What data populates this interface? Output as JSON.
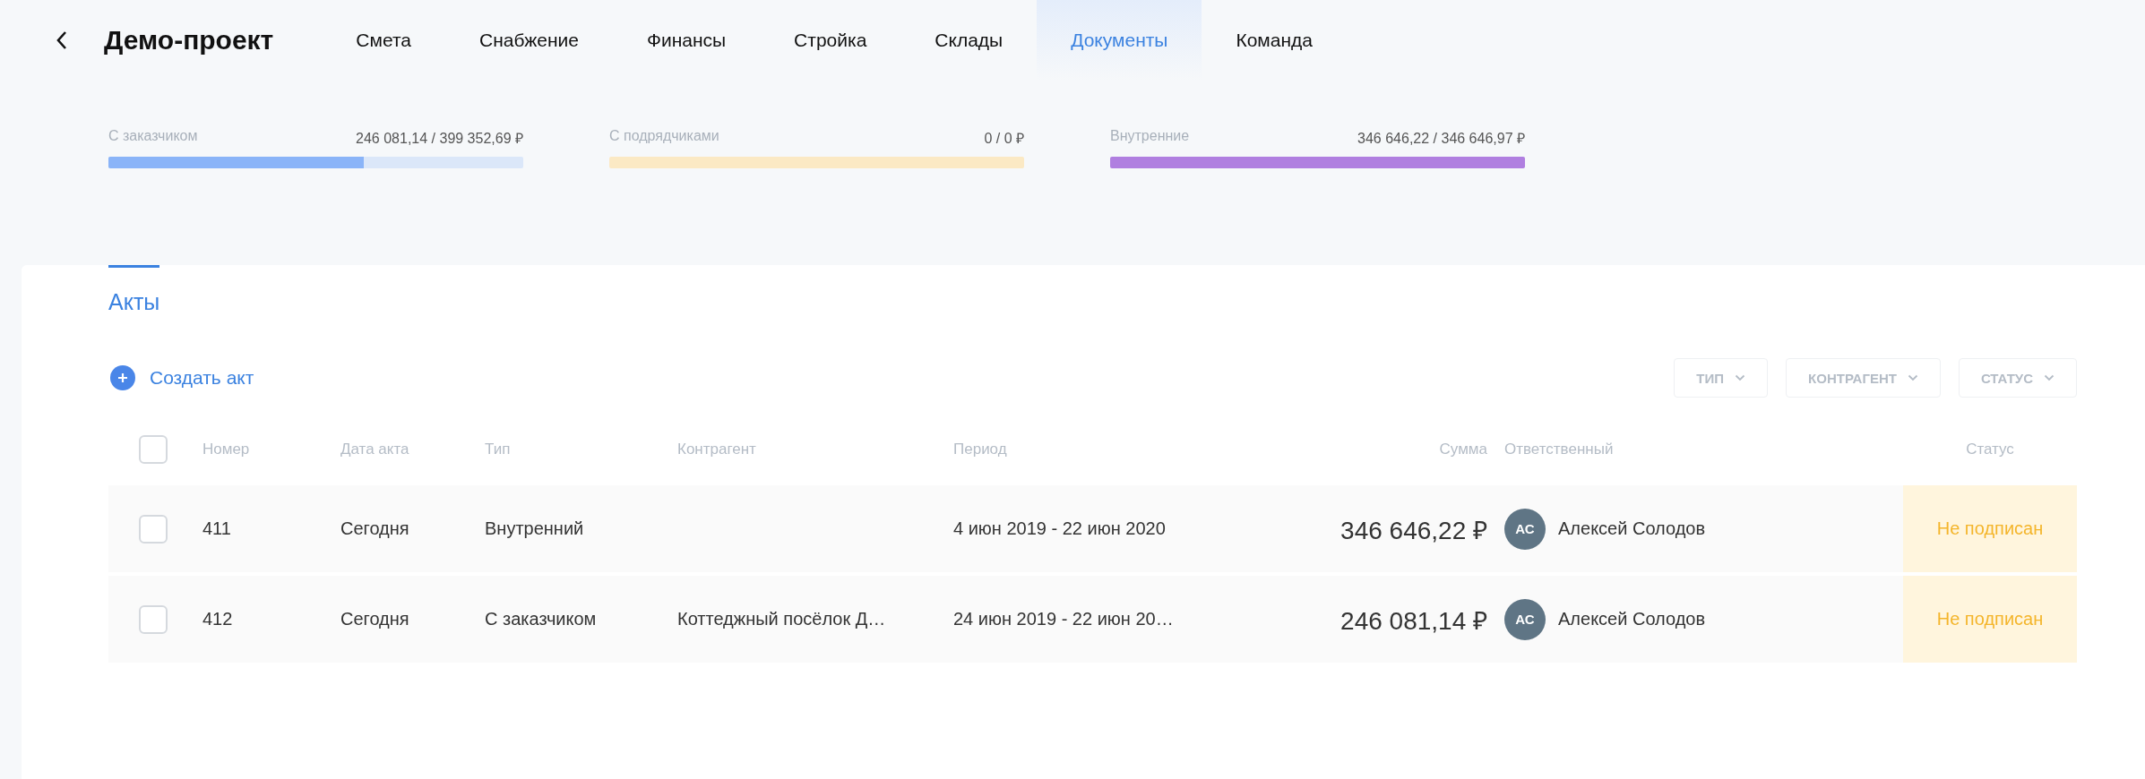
{
  "header": {
    "title": "Демо-проект"
  },
  "nav_tabs": [
    {
      "label": "Смета",
      "selected": false
    },
    {
      "label": "Снабжение",
      "selected": false
    },
    {
      "label": "Финансы",
      "selected": false
    },
    {
      "label": "Стройка",
      "selected": false
    },
    {
      "label": "Склады",
      "selected": false
    },
    {
      "label": "Документы",
      "selected": true
    },
    {
      "label": "Команда",
      "selected": false
    }
  ],
  "summary": [
    {
      "label": "С заказчиком",
      "amount": "246 081,14 / 399 352,69 ₽",
      "level": 0.616,
      "color": "#8ab4f8"
    },
    {
      "label": "С подрядчиками",
      "amount": "0 / 0 ₽",
      "level": 0,
      "color": "#fbe9c4"
    },
    {
      "label": "Внутренние",
      "amount": "346 646,22 / 346 646,97 ₽",
      "level": 1,
      "color": "#b07fe0"
    }
  ],
  "section_tab": {
    "label": "Акты",
    "selected": true
  },
  "create_button": "Создать акт",
  "filters": [
    "ТИП",
    "КОНТРАГЕНТ",
    "СТАТУС"
  ],
  "table": {
    "select_all_checked": false,
    "columns": [
      "Номер",
      "Дата акта",
      "Тип",
      "Контрагент",
      "Период",
      "Сумма",
      "Ответственный",
      "Статус"
    ],
    "rows": [
      {
        "checked": false,
        "number": "411",
        "date": "Сегодня",
        "type": "Внутренний",
        "contractor": "",
        "period": "4 июн 2019 - 22 июн 2020",
        "sum": "346 646,22 ₽",
        "initials": "АС",
        "responsible": "Алексей Солодов",
        "status": {
          "label": "Не подписан",
          "kind": "unsigned"
        }
      },
      {
        "checked": false,
        "number": "412",
        "date": "Сегодня",
        "type": "С заказчиком",
        "contractor": "Коттеджный посёлок Д…",
        "period": "24 июн 2019 - 22 июн 20…",
        "sum": "246 081,14 ₽",
        "initials": "АС",
        "responsible": "Алексей Солодов",
        "status": {
          "label": "Не подписан",
          "kind": "unsigned"
        }
      }
    ]
  }
}
